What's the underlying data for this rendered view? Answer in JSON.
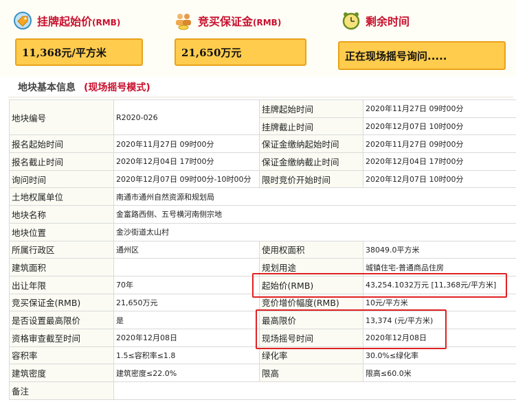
{
  "header": {
    "start_price_label": "挂牌起始价",
    "start_price_unit": "(RMB)",
    "deposit_label": "竞买保证金",
    "deposit_unit": "(RMB)",
    "remaining_label": "剩余时间",
    "start_price_value": "11,368元/平方米",
    "deposit_value": "21,650万元",
    "remaining_value": "正在现场摇号询问....."
  },
  "section": {
    "title": "地块基本信息",
    "mode": "(现场摇号模式)"
  },
  "table": {
    "r1": {
      "k1": "地块编号",
      "v1": "R2020-026",
      "k2": "挂牌起始时间",
      "v2": "2020年11月27日 09时00分"
    },
    "r2": {
      "k2": "挂牌截止时间",
      "v2": "2020年12月07日 10时00分"
    },
    "r3": {
      "k1": "报名起始时间",
      "v1": "2020年11月27日 09时00分",
      "k2": "保证金缴纳起始时间",
      "v2": "2020年11月27日 09时00分"
    },
    "r4": {
      "k1": "报名截止时间",
      "v1": "2020年12月04日 17时00分",
      "k2": "保证金缴纳截止时间",
      "v2": "2020年12月04日 17时00分"
    },
    "r5": {
      "k1": "询问时间",
      "v1": "2020年12月07日 09时00分-10时00分",
      "k2": "限时竞价开始时间",
      "v2": "2020年12月07日 10时00分"
    },
    "r6": {
      "k1": "土地权属单位",
      "v1": "南通市通州自然资源和规划局"
    },
    "r7": {
      "k1": "地块名称",
      "v1": "金富路西侧、五号横河南侧宗地"
    },
    "r8": {
      "k1": "地块位置",
      "v1": "金沙街道太山村"
    },
    "r9": {
      "k1": "所属行政区",
      "v1": "通州区",
      "k2": "使用权面积",
      "v2": "38049.0平方米"
    },
    "r10": {
      "k1": "建筑面积",
      "v1": "",
      "k2": "规划用途",
      "v2": "城镇住宅-普通商品住房"
    },
    "r11": {
      "k1": "出让年限",
      "v1": "70年",
      "k2": "起始价(RMB)",
      "v2": "43,254.1032万元 [11,368元/平方米]"
    },
    "r12": {
      "k1": "竞买保证金(RMB)",
      "v1": "21,650万元",
      "k2": "竞价增价幅度(RMB)",
      "v2": "10元/平方米"
    },
    "r13": {
      "k1": "是否设置最高限价",
      "v1": "是",
      "k2": "最高限价",
      "v2": "13,374 (元/平方米)"
    },
    "r14": {
      "k1": "资格审查截至时间",
      "v1": "2020年12月08日",
      "k2": "现场摇号时间",
      "v2": "2020年12月08日"
    },
    "r15": {
      "k1": "容积率",
      "v1": "1.5≤容积率≤1.8",
      "k2": "绿化率",
      "v2": "30.0%≤绿化率"
    },
    "r16": {
      "k1": "建筑密度",
      "v1": "建筑密度≤22.0%",
      "k2": "限高",
      "v2": "限高≤60.0米"
    },
    "r17": {
      "k1": "备注",
      "v1": ""
    }
  },
  "colors": {
    "accent_red": "#c8102e",
    "box_fill": "#ffcc4d",
    "highlight_border": "#e02020"
  },
  "icons": [
    "price-tag-icon",
    "people-coins-icon",
    "alarm-clock-icon"
  ]
}
